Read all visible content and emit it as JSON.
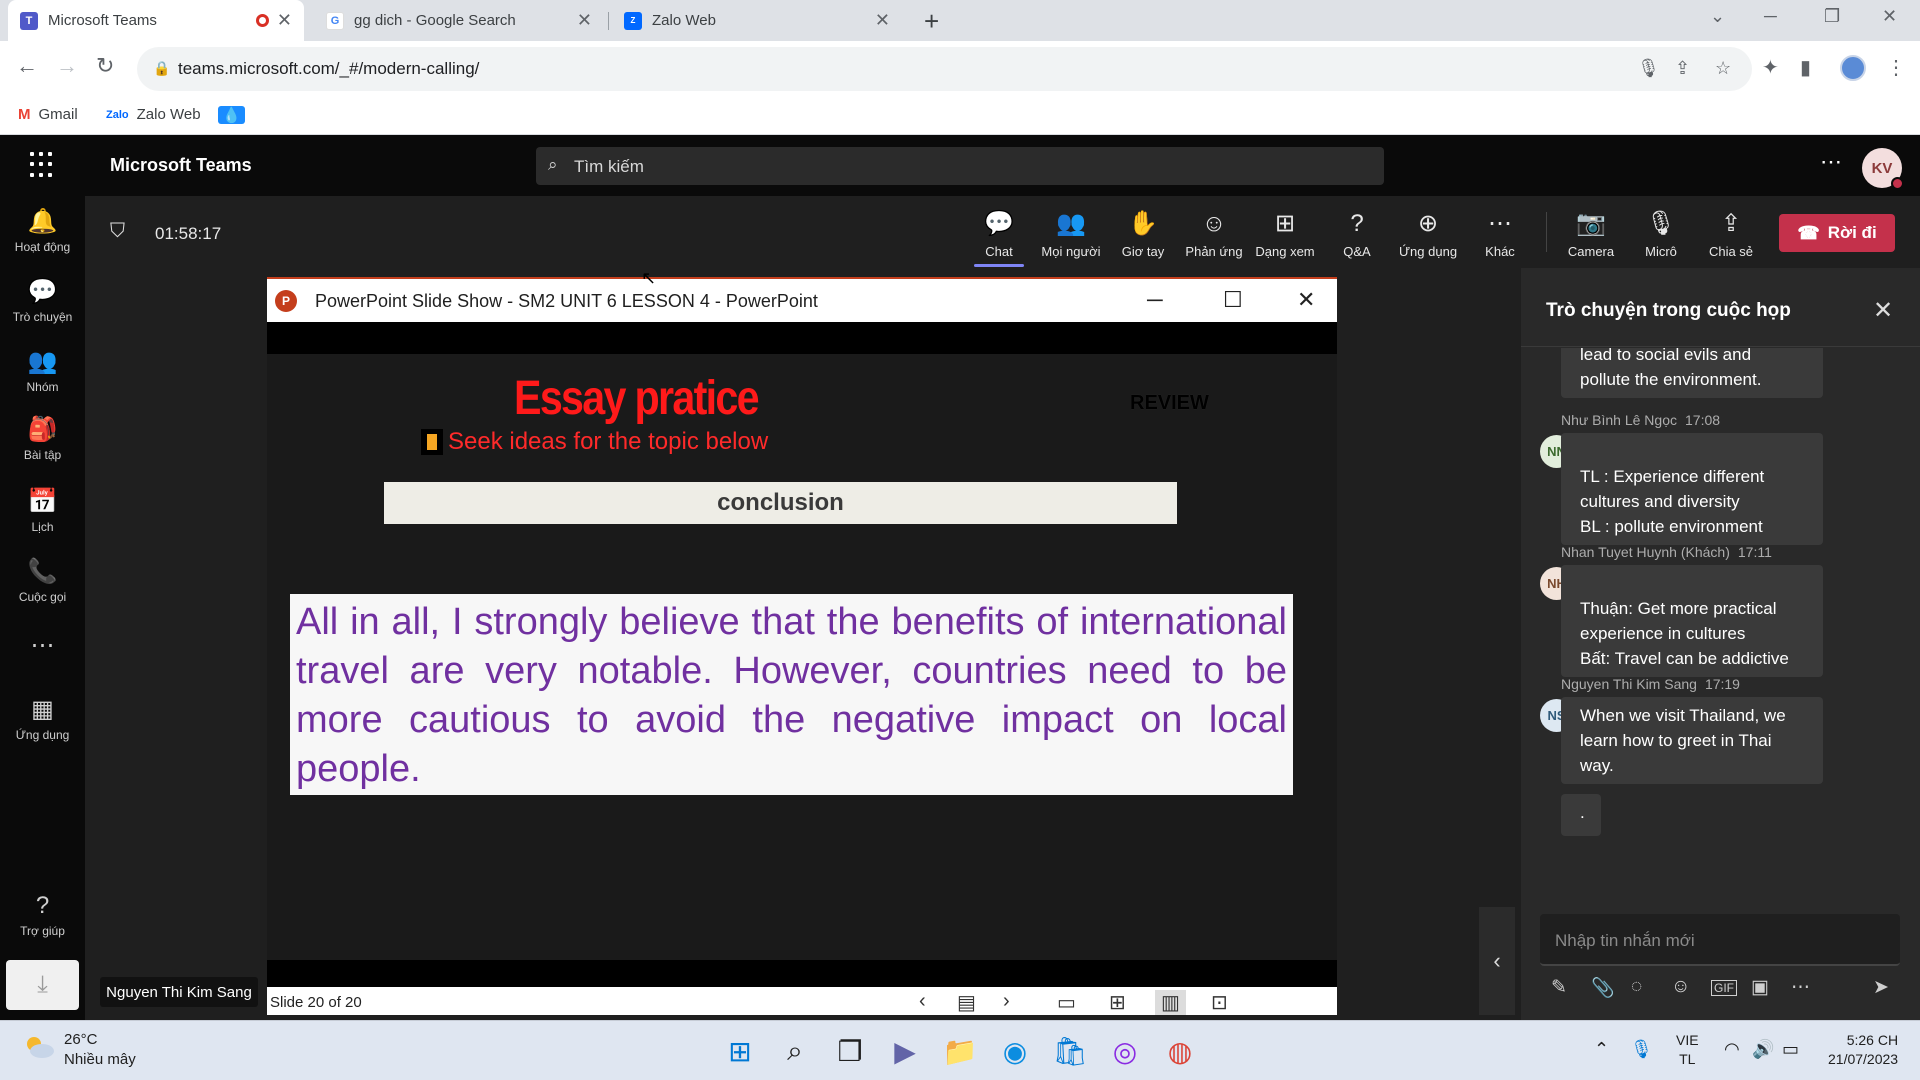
{
  "browser": {
    "tabs": [
      {
        "title": "Microsoft Teams",
        "close": "✕"
      },
      {
        "title": "gg dich - Google Search",
        "close": "✕"
      },
      {
        "title": "Zalo Web",
        "close": "✕"
      }
    ],
    "new_tab": "+",
    "url": "teams.microsoft.com/_#/modern-calling/",
    "bookmarks": [
      {
        "label": "Gmail"
      },
      {
        "label": "Zalo Web"
      }
    ]
  },
  "teams": {
    "app_title": "Microsoft Teams",
    "search_placeholder": "Tìm kiếm",
    "avatar_initials": "KV",
    "rail": [
      {
        "label": "Hoạt động",
        "icon": "bell-icon",
        "glyph": "🔔"
      },
      {
        "label": "Trò chuyện",
        "icon": "chat-icon",
        "glyph": "💬"
      },
      {
        "label": "Nhóm",
        "icon": "teams-icon",
        "glyph": "👥"
      },
      {
        "label": "Bài tập",
        "icon": "assignments-icon",
        "glyph": "🎒"
      },
      {
        "label": "Lịch",
        "icon": "calendar-icon",
        "glyph": "📅"
      },
      {
        "label": "Cuộc gọi",
        "icon": "phone-icon",
        "glyph": "📞"
      },
      {
        "label": "",
        "icon": "more-icon",
        "glyph": "⋯"
      },
      {
        "label": "Ứng dụng",
        "icon": "apps-icon",
        "glyph": "▦"
      },
      {
        "label": "Trợ giúp",
        "icon": "help-icon",
        "glyph": "?"
      }
    ]
  },
  "meeting": {
    "timer": "01:58:17",
    "toolbar": [
      {
        "label": "Chat",
        "icon": "chat-icon",
        "glyph": "💬"
      },
      {
        "label": "Mọi người",
        "icon": "people-icon",
        "glyph": "👥"
      },
      {
        "label": "Giơ tay",
        "icon": "raise-hand-icon",
        "glyph": "✋"
      },
      {
        "label": "Phản ứng",
        "icon": "emoji-icon",
        "glyph": "☺"
      },
      {
        "label": "Dạng xem",
        "icon": "view-icon",
        "glyph": "⊞"
      },
      {
        "label": "Q&A",
        "icon": "qa-icon",
        "glyph": "?"
      },
      {
        "label": "Ứng dụng",
        "icon": "add-app-icon",
        "glyph": "⊕"
      },
      {
        "label": "Khác",
        "icon": "more-icon",
        "glyph": "⋯"
      },
      {
        "label": "Camera",
        "icon": "camera-off-icon",
        "glyph": "📷"
      },
      {
        "label": "Micrô",
        "icon": "mic-off-icon",
        "glyph": "🎙"
      },
      {
        "label": "Chia sẻ",
        "icon": "share-icon",
        "glyph": "⇪"
      }
    ],
    "leave_label": "Rời đi",
    "presenter_name": "Nguyen Thi Kim Sang"
  },
  "ppt": {
    "window_title": "PowerPoint Slide Show  -  SM2 UNIT 6 LESSON 4 - PowerPoint",
    "slide": {
      "heading": "Essay pratice",
      "review": "REVIEW",
      "subheading": "Seek ideas for the topic below",
      "section": "conclusion",
      "paragraph": "All in all, I strongly believe that the benefits of international travel are very notable. However, countries need to be more cautious to avoid the negative impact on local people."
    },
    "slide_counter": "Slide 20 of 20"
  },
  "chat": {
    "title": "Trò chuyện trong cuộc họp",
    "partial_message": "lead to social evils and pollute the environment.",
    "messages": [
      {
        "author": "Như Bình Lê Ngọc",
        "time": "17:08",
        "initials": "NN",
        "text": "TL : Experience different cultures and diversity\nBL : pollute environment"
      },
      {
        "author": "Nhan Tuyet Huynh (Khách)",
        "time": "17:11",
        "initials": "NH",
        "text": "Thuận: Get more practical experience in cultures\nBất: Travel can be addictive"
      },
      {
        "author": "Nguyen Thi Kim Sang",
        "time": "17:19",
        "initials": "NS",
        "text": "When we visit Thailand, we learn how to greet in Thai way."
      }
    ],
    "trailing_message": ".",
    "compose_placeholder": "Nhập tin nhắn mới"
  },
  "taskbar": {
    "temperature": "26°C",
    "weather": "Nhiều mây",
    "language": "VIE",
    "keyboard": "TL",
    "time": "5:26 CH",
    "date": "21/07/2023"
  }
}
